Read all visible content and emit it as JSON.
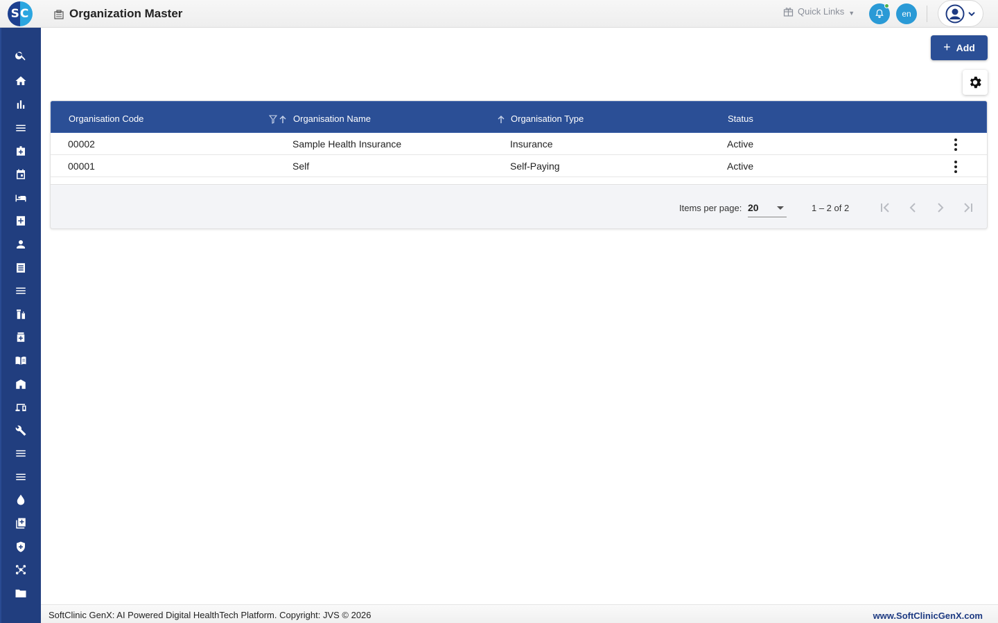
{
  "header": {
    "logo_text": "SC",
    "title": "Organization Master",
    "quick_links_label": "Quick Links",
    "language": "en",
    "notification_icon": "bell-icon",
    "user_icon": "account-circle-icon"
  },
  "sidebar": {
    "items": [
      {
        "icon": "search-icon"
      },
      {
        "icon": "home-icon"
      },
      {
        "icon": "bar-chart-icon"
      },
      {
        "icon": "menu-icon"
      },
      {
        "icon": "medical-bag-icon"
      },
      {
        "icon": "calendar-icon"
      },
      {
        "icon": "bed-icon"
      },
      {
        "icon": "medical-plus-icon"
      },
      {
        "icon": "person-icon"
      },
      {
        "icon": "receipt-icon"
      },
      {
        "icon": "menu-icon"
      },
      {
        "icon": "medication-icon"
      },
      {
        "icon": "medicine-box-icon"
      },
      {
        "icon": "book-icon"
      },
      {
        "icon": "store-icon"
      },
      {
        "icon": "devices-icon"
      },
      {
        "icon": "wrench-icon"
      },
      {
        "icon": "menu-icon"
      },
      {
        "icon": "menu-icon"
      },
      {
        "icon": "blood-drop-icon"
      },
      {
        "icon": "add-library-icon"
      },
      {
        "icon": "shield-plus-icon"
      },
      {
        "icon": "hub-icon"
      },
      {
        "icon": "folder-icon"
      }
    ]
  },
  "toolbar": {
    "add_label": "Add",
    "settings_icon": "gear-icon"
  },
  "table": {
    "columns": [
      "Organisation Code",
      "Organisation Name",
      "Organisation Type",
      "Status"
    ],
    "rows": [
      {
        "code": "00002",
        "name": "Sample Health Insurance",
        "type": "Insurance",
        "status": "Active"
      },
      {
        "code": "00001",
        "name": "Self",
        "type": "Self-Paying",
        "status": "Active"
      }
    ]
  },
  "paginator": {
    "items_per_page_label": "Items per page:",
    "items_per_page_value": "20",
    "range_label": "1 – 2 of 2"
  },
  "footer": {
    "copyright": "SoftClinic GenX: AI Powered Digital HealthTech Platform. Copyright: JVS © 2026",
    "website": "www.SoftClinicGenX.com"
  },
  "colors": {
    "sidebar": "#213e7f",
    "header_row": "#2b4f96",
    "accent": "#2a9ad6"
  }
}
